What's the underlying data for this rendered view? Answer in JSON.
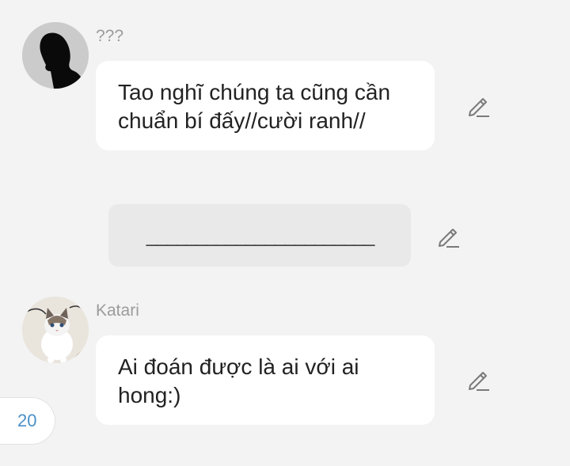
{
  "messages": [
    {
      "sender": "???",
      "avatar": "silhouette-avatar",
      "text_lines": [
        "Tao nghĩ chúng ta cũng cần",
        "chuẩn bí đấy//cười ranh//"
      ]
    },
    {
      "type": "separator",
      "text": "_______________________"
    },
    {
      "sender": "Katari",
      "avatar": "cat-avatar",
      "text_lines": [
        "Ai đoán được là ai với ai",
        "hong:)"
      ]
    }
  ],
  "page_badge": "20",
  "colors": {
    "background": "#f3f3f3",
    "bubble": "#ffffff",
    "system_bubble": "#e9e9e9",
    "name": "#9b9b9b",
    "badge_text": "#4a90c8",
    "icon": "#7a7a7a"
  }
}
